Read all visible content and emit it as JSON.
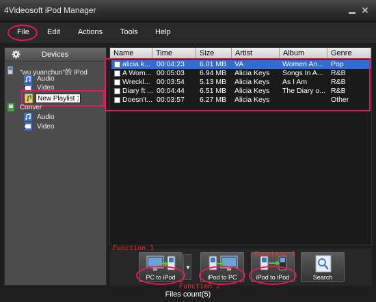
{
  "window": {
    "title": "4Videosoft iPod Manager"
  },
  "menu": {
    "file": "File",
    "edit": "Edit",
    "actions": "Actions",
    "tools": "Tools",
    "help": "Help"
  },
  "sidebar": {
    "header": "Devices",
    "device_name": "\"wu yuanchun\"的 iPod",
    "items": [
      "Audio",
      "Video"
    ],
    "playlist_edit_value": "New Playlist 1",
    "converter": "Conver",
    "converter_items": [
      "Audio",
      "Video"
    ]
  },
  "table": {
    "columns": [
      "Name",
      "Time",
      "Size",
      "Artist",
      "Album",
      "Genre"
    ],
    "rows": [
      {
        "name": "alicia k...",
        "time": "00:04:23",
        "size": "6.01 MB",
        "artist": "VA",
        "album": "Women An...",
        "genre": "Pop"
      },
      {
        "name": "A Wom...",
        "time": "00:05:03",
        "size": "6.94 MB",
        "artist": "Alicia Keys",
        "album": "Songs In A...",
        "genre": "R&B"
      },
      {
        "name": "Wreckl...",
        "time": "00:03:54",
        "size": "5.13 MB",
        "artist": "Alicia Keys",
        "album": "As I Am",
        "genre": "R&B"
      },
      {
        "name": "Diary ft ...",
        "time": "00:04:44",
        "size": "6.51 MB",
        "artist": "Alicia Keys",
        "album": "The Diary o...",
        "genre": "R&B"
      },
      {
        "name": "Doesn't...",
        "time": "00:03:57",
        "size": "6.27 MB",
        "artist": "Alicia Keys",
        "album": "",
        "genre": "Other"
      }
    ]
  },
  "buttons": {
    "pc_to_ipod": "PC to iPod",
    "ipod_to_pc": "iPod to PC",
    "ipod_to_ipod": "iPod to iPod",
    "search": "Search"
  },
  "annotations": {
    "function1": "Function 1",
    "function2": "Function 2",
    "function3": "Function 3"
  },
  "status": {
    "files_count": "Files count(5)"
  },
  "colors": {
    "accent_highlight": "#e8185a",
    "selection": "#2f6cd6",
    "annotation_text": "#ff2a2a"
  }
}
